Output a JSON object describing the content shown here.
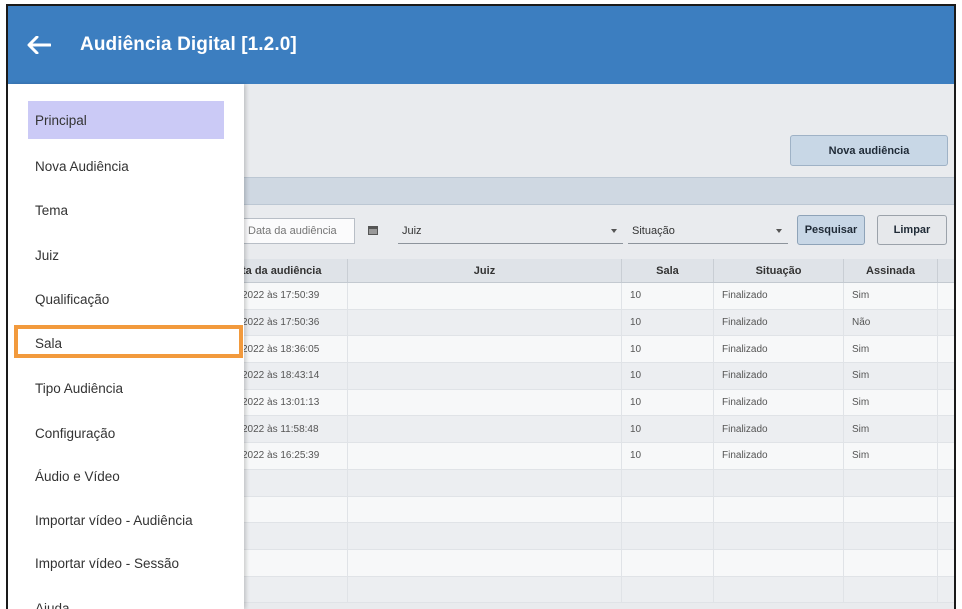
{
  "header": {
    "title": "Audiência Digital [1.2.0]"
  },
  "main": {
    "new_button": "Nova audiência",
    "filters": {
      "date_placeholder": "Data da audiência",
      "juiz": "Juiz",
      "situacao": "Situação",
      "search_button": "Pesquisar",
      "clear_button": "Limpar"
    },
    "table": {
      "columns": [
        "ta da audiência",
        "Juiz",
        "Sala",
        "Situação",
        "Assinada"
      ],
      "rows": [
        [
          "2022 às 17:50:39",
          "",
          "10",
          "Finalizado",
          "Sim"
        ],
        [
          "2022 às 17:50:36",
          "",
          "10",
          "Finalizado",
          "Não"
        ],
        [
          "2022 às 18:36:05",
          "",
          "10",
          "Finalizado",
          "Sim"
        ],
        [
          "2022 às 18:43:14",
          "",
          "10",
          "Finalizado",
          "Sim"
        ],
        [
          "2022 às 13:01:13",
          "",
          "10",
          "Finalizado",
          "Sim"
        ],
        [
          "2022 às 11:58:48",
          "",
          "10",
          "Finalizado",
          "Sim"
        ],
        [
          "2022 às 16:25:39",
          "",
          "10",
          "Finalizado",
          "Sim"
        ],
        [
          "",
          "",
          "",
          "",
          ""
        ],
        [
          "",
          "",
          "",
          "",
          ""
        ],
        [
          "",
          "",
          "",
          "",
          ""
        ],
        [
          "",
          "",
          "",
          "",
          ""
        ],
        [
          "",
          "",
          "",
          "",
          ""
        ]
      ]
    }
  },
  "drawer": {
    "items": [
      {
        "label": "Principal",
        "active": true
      },
      {
        "label": "Nova Audiência"
      },
      {
        "label": "Tema"
      },
      {
        "label": "Juiz"
      },
      {
        "label": "Qualificação"
      },
      {
        "label": "Sala",
        "highlighted": true
      },
      {
        "label": "Tipo Audiência"
      },
      {
        "label": "Configuração"
      },
      {
        "label": "Áudio e Vídeo"
      },
      {
        "label": "Importar vídeo - Audiência"
      },
      {
        "label": "Importar vídeo - Sessão"
      },
      {
        "label": "Ajuda"
      }
    ]
  },
  "colors": {
    "header": "#3c7ec0",
    "active_item": "#cbcaf6",
    "highlight": "#f29a3d"
  }
}
